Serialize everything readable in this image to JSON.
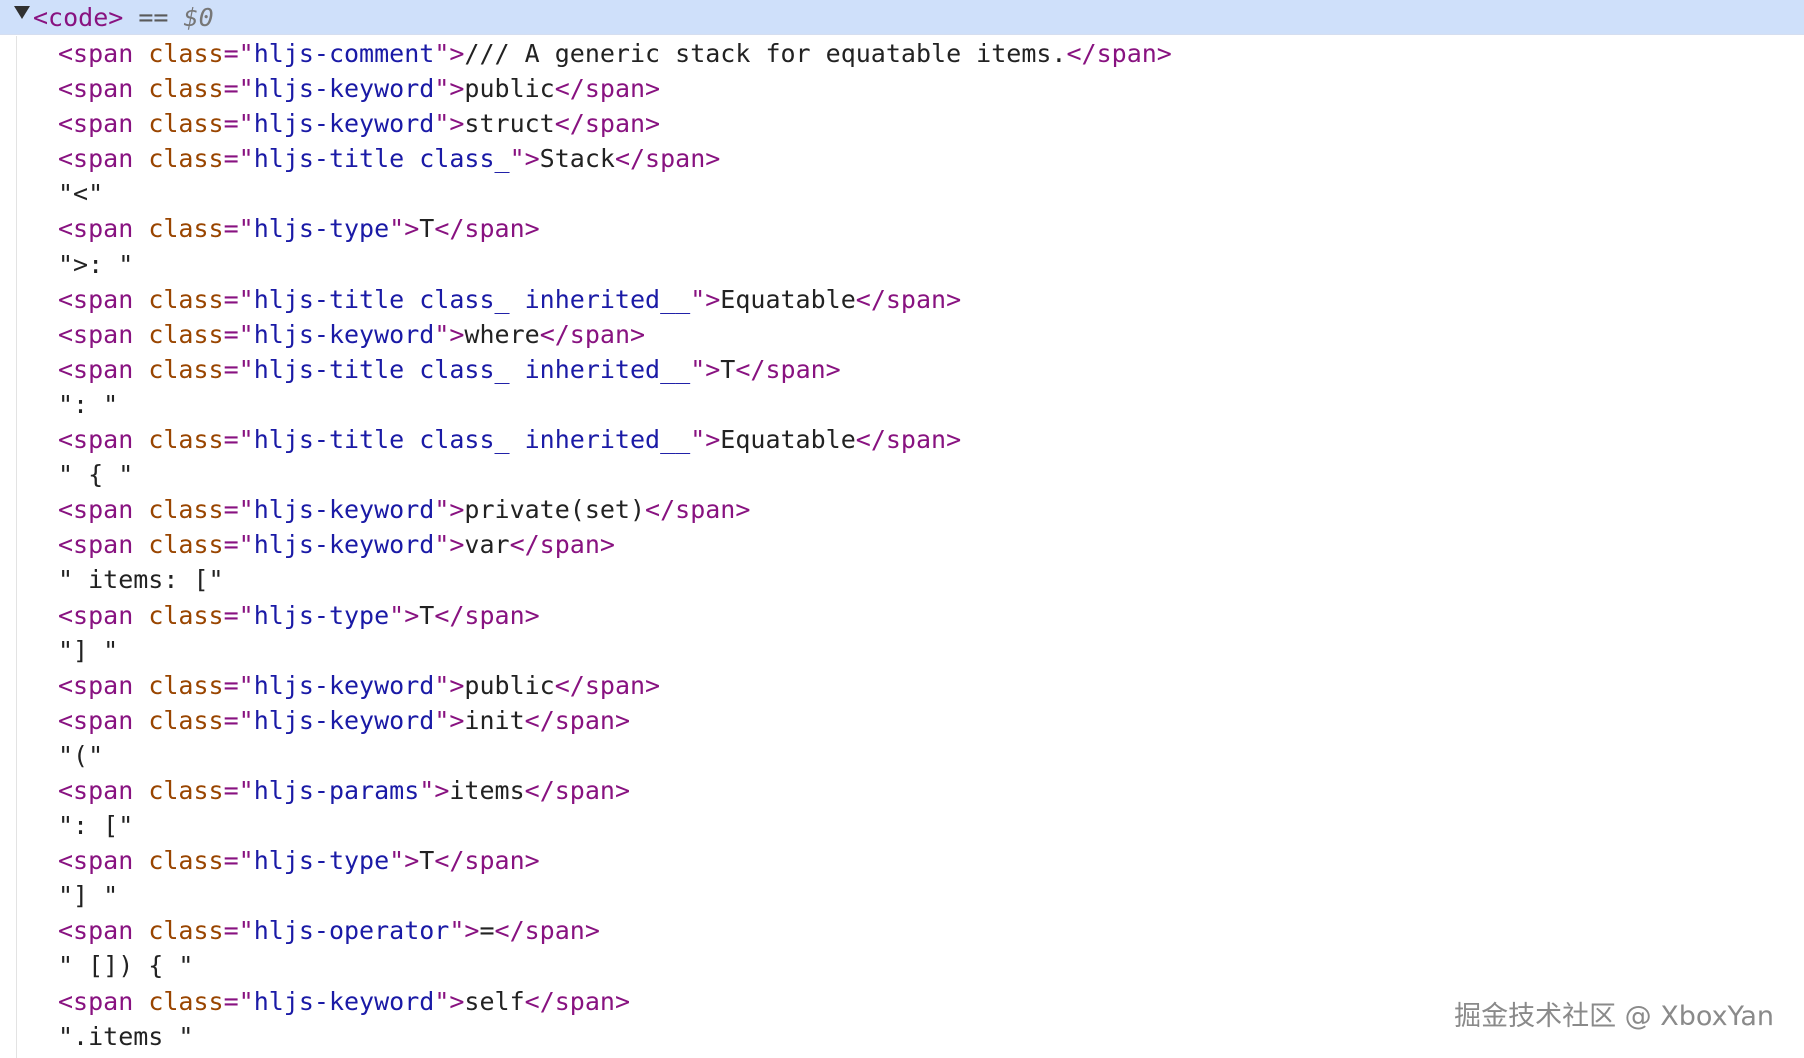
{
  "header": {
    "open_tag": "<code>",
    "eq": " == ",
    "ref": "$0"
  },
  "rows": [
    {
      "type": "span",
      "cls": "hljs-comment",
      "text": "/// A generic stack for equatable items."
    },
    {
      "type": "span",
      "cls": "hljs-keyword",
      "text": "public"
    },
    {
      "type": "span",
      "cls": "hljs-keyword",
      "text": "struct"
    },
    {
      "type": "span",
      "cls": "hljs-title class_",
      "text": "Stack"
    },
    {
      "type": "text",
      "text": "\"<\""
    },
    {
      "type": "span",
      "cls": "hljs-type",
      "text": "T"
    },
    {
      "type": "text",
      "text": "\">: \""
    },
    {
      "type": "span",
      "cls": "hljs-title class_ inherited__",
      "text": "Equatable"
    },
    {
      "type": "span",
      "cls": "hljs-keyword",
      "text": "where"
    },
    {
      "type": "span",
      "cls": "hljs-title class_ inherited__",
      "text": "T"
    },
    {
      "type": "text",
      "text": "\": \""
    },
    {
      "type": "span",
      "cls": "hljs-title class_ inherited__",
      "text": "Equatable"
    },
    {
      "type": "text",
      "text": "\" { \""
    },
    {
      "type": "span",
      "cls": "hljs-keyword",
      "text": "private(set)"
    },
    {
      "type": "span",
      "cls": "hljs-keyword",
      "text": "var"
    },
    {
      "type": "text",
      "text": "\" items: [\""
    },
    {
      "type": "span",
      "cls": "hljs-type",
      "text": "T"
    },
    {
      "type": "text",
      "text": "\"] \""
    },
    {
      "type": "span",
      "cls": "hljs-keyword",
      "text": "public"
    },
    {
      "type": "span",
      "cls": "hljs-keyword",
      "text": "init"
    },
    {
      "type": "text",
      "text": "\"(\""
    },
    {
      "type": "span",
      "cls": "hljs-params",
      "text": "items"
    },
    {
      "type": "text",
      "text": "\": [\""
    },
    {
      "type": "span",
      "cls": "hljs-type",
      "text": "T"
    },
    {
      "type": "text",
      "text": "\"] \""
    },
    {
      "type": "span",
      "cls": "hljs-operator",
      "text": "="
    },
    {
      "type": "text",
      "text": "\" []) { \""
    },
    {
      "type": "span",
      "cls": "hljs-keyword",
      "text": "self"
    },
    {
      "type": "text",
      "text": "\".items \""
    }
  ],
  "watermark": "掘金技术社区 @ XboxYan",
  "colors": {
    "tag": "#881280",
    "attr_name": "#994500",
    "attr_value": "#1a1aa6",
    "text": "#222222",
    "selected_row_bg": "#cfe0fa"
  }
}
